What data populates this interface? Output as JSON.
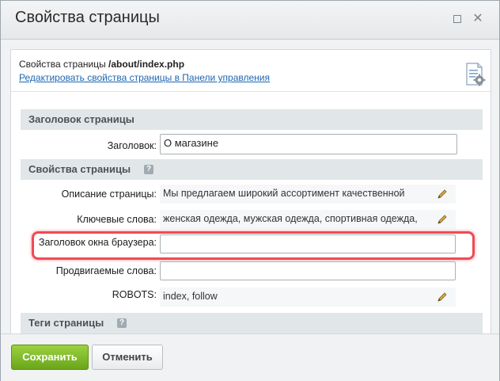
{
  "window": {
    "title": "Свойства страницы"
  },
  "info": {
    "title_prefix": "Свойства страницы ",
    "title_path": "/about/index.php",
    "link": "Редактировать свойства страницы в Панели управления"
  },
  "sections": {
    "header": "Заголовок страницы",
    "properties": "Свойства страницы",
    "tags": "Теги страницы",
    "help_glyph": "?"
  },
  "fields": {
    "title_label": "Заголовок:",
    "title_value": "О магазине",
    "description_label": "Описание страницы:",
    "description_value": "Мы предлагаем широкий ассортимент качественной",
    "keywords_label": "Ключевые слова:",
    "keywords_value": "женская одежда, мужская одежда, спортивная одежда,",
    "browser_title_label": "Заголовок окна браузера:",
    "browser_title_value": "",
    "promoted_label": "Продвигаемые слова:",
    "promoted_value": "",
    "robots_label": "ROBOTS:",
    "robots_value": "index, follow"
  },
  "buttons": {
    "save": "Сохранить",
    "cancel": "Отменить"
  },
  "colors": {
    "save_button": "#79b32a",
    "highlight": "#f04b55",
    "link": "#2067b0"
  }
}
